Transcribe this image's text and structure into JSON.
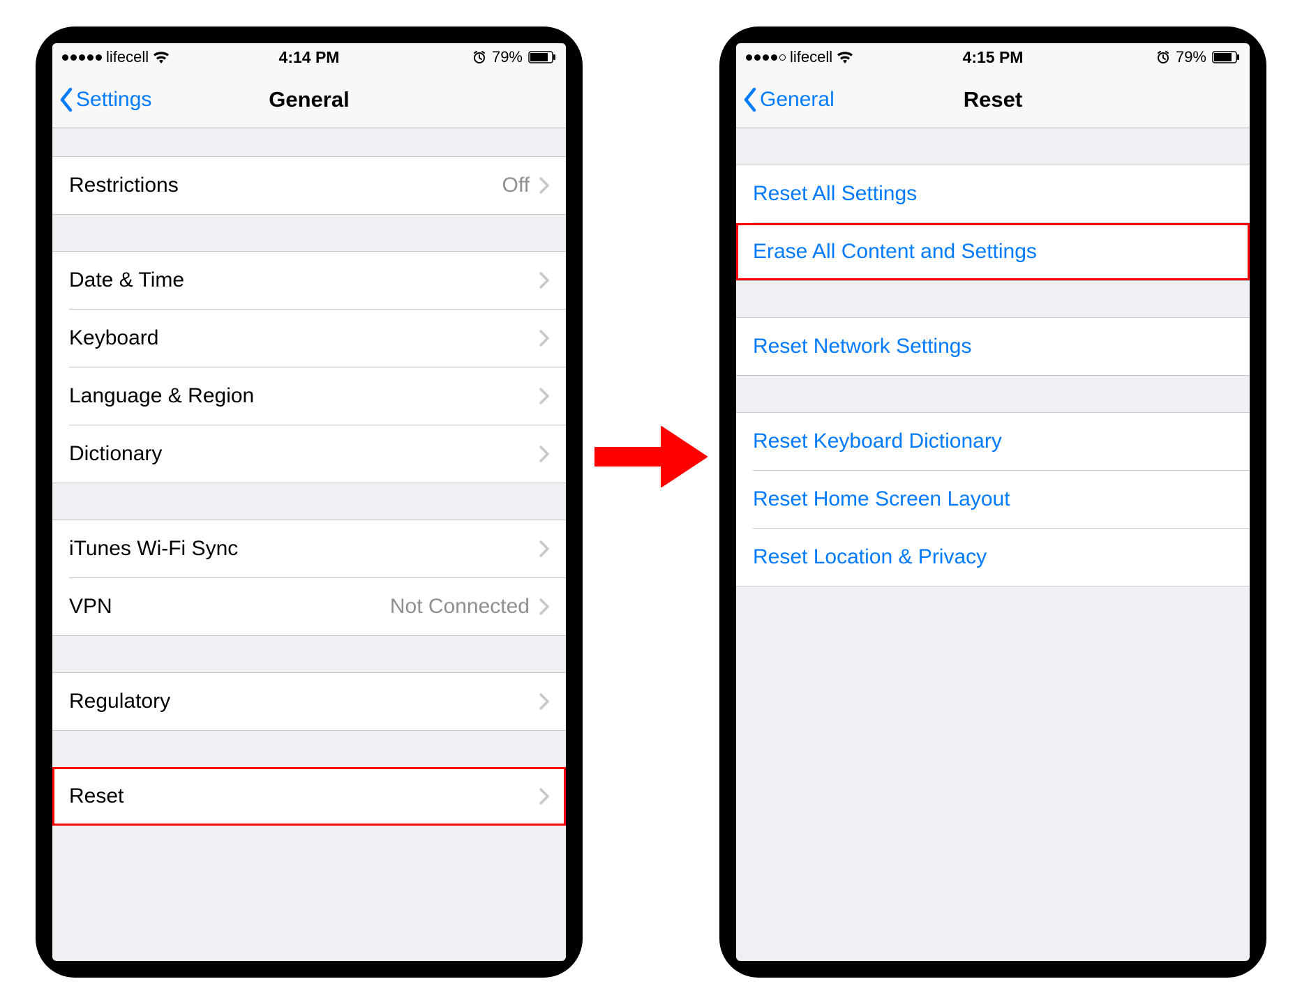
{
  "left": {
    "statusbar": {
      "carrier": "lifecell",
      "time": "4:14 PM",
      "battery": "79%",
      "signal_dots_filled": 5
    },
    "nav": {
      "back": "Settings",
      "title": "General"
    },
    "rows": {
      "restrictions": {
        "label": "Restrictions",
        "detail": "Off"
      },
      "date_time": {
        "label": "Date & Time"
      },
      "keyboard": {
        "label": "Keyboard"
      },
      "lang_region": {
        "label": "Language & Region"
      },
      "dictionary": {
        "label": "Dictionary"
      },
      "itunes_sync": {
        "label": "iTunes Wi-Fi Sync"
      },
      "vpn": {
        "label": "VPN",
        "detail": "Not Connected"
      },
      "regulatory": {
        "label": "Regulatory"
      },
      "reset": {
        "label": "Reset"
      }
    }
  },
  "right": {
    "statusbar": {
      "carrier": "lifecell",
      "time": "4:15 PM",
      "battery": "79%",
      "signal_dots_filled": 4
    },
    "nav": {
      "back": "General",
      "title": "Reset"
    },
    "rows": {
      "reset_all": {
        "label": "Reset All Settings"
      },
      "erase_all": {
        "label": "Erase All Content and Settings"
      },
      "reset_network": {
        "label": "Reset Network Settings"
      },
      "reset_keyboard": {
        "label": "Reset Keyboard Dictionary"
      },
      "reset_home": {
        "label": "Reset Home Screen Layout"
      },
      "reset_location": {
        "label": "Reset Location & Privacy"
      }
    }
  }
}
